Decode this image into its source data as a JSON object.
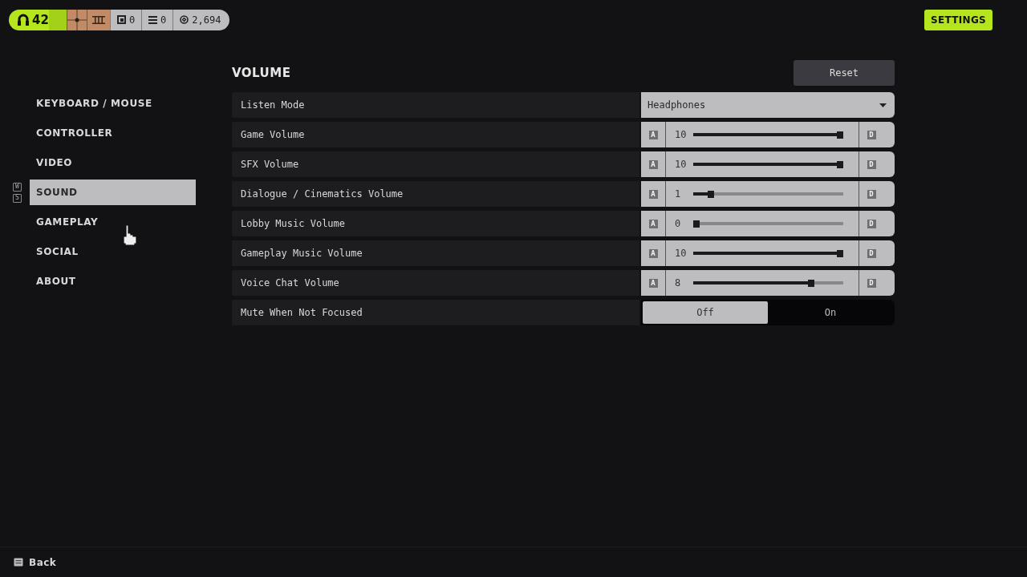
{
  "top_bar": {
    "level": "42",
    "stats": [
      {
        "kind": "box",
        "value": "0"
      },
      {
        "kind": "list",
        "value": "0"
      },
      {
        "kind": "coin",
        "value": "2,694"
      }
    ],
    "settings_button": "SETTINGS"
  },
  "sidebar": {
    "keys": [
      "W",
      "S"
    ],
    "items": [
      {
        "label": "KEYBOARD / MOUSE",
        "selected": false
      },
      {
        "label": "CONTROLLER",
        "selected": false
      },
      {
        "label": "VIDEO",
        "selected": false
      },
      {
        "label": "SOUND",
        "selected": true
      },
      {
        "label": "GAMEPLAY",
        "selected": false
      },
      {
        "label": "SOCIAL",
        "selected": false
      },
      {
        "label": "ABOUT",
        "selected": false
      }
    ]
  },
  "section": {
    "title": "VOLUME",
    "reset_button": "Reset"
  },
  "settings": [
    {
      "kind": "dropdown",
      "label": "Listen Mode",
      "value": "Headphones"
    },
    {
      "kind": "slider",
      "label": "Game Volume",
      "reading": "10",
      "level": 1.0,
      "left_key": "A",
      "right_key": "D"
    },
    {
      "kind": "slider",
      "label": "SFX Volume",
      "reading": "10",
      "level": 1.0,
      "left_key": "A",
      "right_key": "D"
    },
    {
      "kind": "slider",
      "label": "Dialogue / Cinematics Volume",
      "reading": "1",
      "level": 0.1,
      "left_key": "A",
      "right_key": "D"
    },
    {
      "kind": "slider",
      "label": "Lobby Music Volume",
      "reading": "0",
      "level": 0.0,
      "left_key": "A",
      "right_key": "D"
    },
    {
      "kind": "slider",
      "label": "Gameplay Music Volume",
      "reading": "10",
      "level": 1.0,
      "left_key": "A",
      "right_key": "D"
    },
    {
      "kind": "slider",
      "label": "Voice Chat Volume",
      "reading": "8",
      "level": 0.8,
      "left_key": "A",
      "right_key": "D"
    },
    {
      "kind": "toggle",
      "label": "Mute When Not Focused",
      "options": [
        {
          "label": "Off",
          "selected": true
        },
        {
          "label": "On",
          "selected": false
        }
      ]
    }
  ],
  "footer": {
    "back": "Back"
  }
}
